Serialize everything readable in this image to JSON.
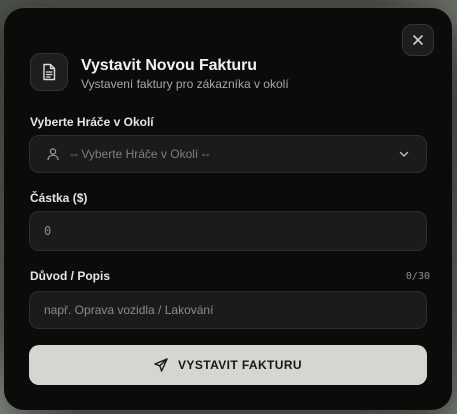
{
  "modal": {
    "title": "Vystavit Novou Fakturu",
    "subtitle": "Vystavení faktury pro zákazníka v okolí",
    "header_icon": "document-icon",
    "close_icon": "close-icon"
  },
  "player_select": {
    "label": "Vyberte Hráče v Okolí",
    "placeholder": "-- Vyberte Hráče v Okolí --",
    "icon": "user-icon",
    "chevron": "chevron-down-icon"
  },
  "amount": {
    "label": "Částka ($)",
    "placeholder": "0"
  },
  "reason": {
    "label": "Důvod / Popis",
    "counter": "0/30",
    "placeholder": "např. Oprava vozidla / Lakování"
  },
  "submit": {
    "label": "VYSTAVIT FAKTURU",
    "icon": "send-icon"
  },
  "colors": {
    "modal_bg": "#0b0b0a",
    "field_bg": "#1b1b1a",
    "button_bg": "#d6d6d0"
  }
}
